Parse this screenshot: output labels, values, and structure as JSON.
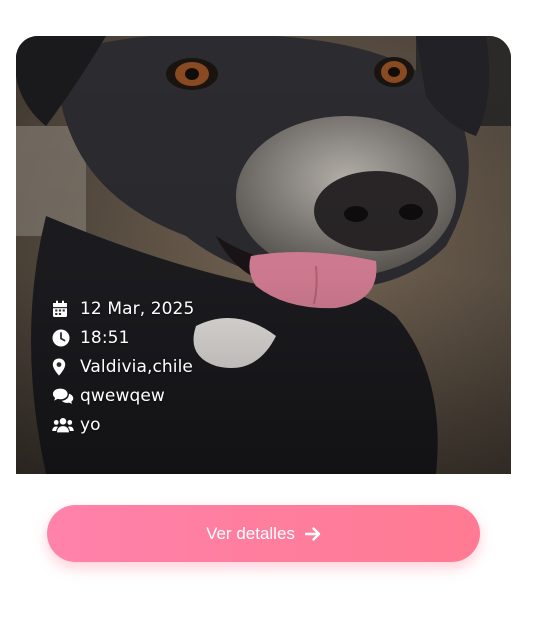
{
  "event": {
    "date": "12 Mar, 2025",
    "time": "18:51",
    "location": "Valdivia,chile",
    "description": "qwewqew",
    "organizer": "yo"
  },
  "icons": {
    "date": "calendar-icon",
    "time": "clock-icon",
    "location": "map-pin-icon",
    "description": "comments-icon",
    "organizer": "users-icon",
    "cta": "arrow-right-icon"
  },
  "cta": {
    "label": "Ver detalles"
  },
  "colors": {
    "cta_start": "#ff82ab",
    "cta_end": "#ff7a92",
    "text_on_image": "#ffffff"
  }
}
